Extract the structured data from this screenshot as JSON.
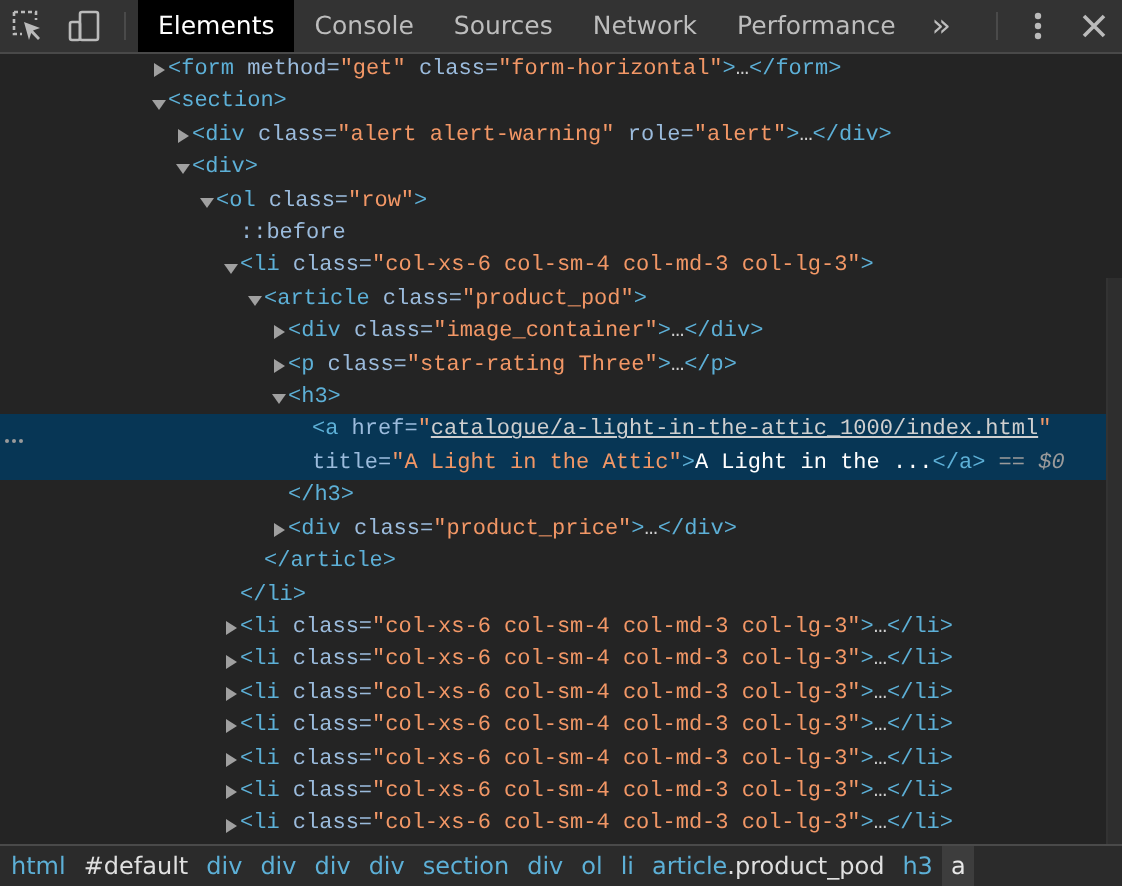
{
  "toolbar": {
    "tabs": [
      {
        "label": "Elements",
        "selected": true
      },
      {
        "label": "Console",
        "selected": false
      },
      {
        "label": "Sources",
        "selected": false
      },
      {
        "label": "Network",
        "selected": false
      },
      {
        "label": "Performance",
        "selected": false
      }
    ],
    "overflow": "»"
  },
  "dom_tree": [
    {
      "selected": false,
      "expanded": false,
      "parts": [
        {
          "kind": "tag",
          "text": "<form"
        },
        {
          "kind": "attr",
          "text": " method="
        },
        {
          "kind": "value",
          "text": "\"get\""
        },
        {
          "kind": "attr",
          "text": " class="
        },
        {
          "kind": "value",
          "text": "\"form-horizontal\""
        },
        {
          "kind": "tag",
          "text": ">"
        },
        {
          "kind": "text",
          "text": "…"
        },
        {
          "kind": "tag",
          "text": "</form>"
        }
      ]
    },
    {
      "selected": false,
      "expanded": true,
      "parts": [
        {
          "kind": "tag",
          "text": "<section>"
        }
      ],
      "children": [
        {
          "selected": false,
          "expanded": false,
          "parts": [
            {
              "kind": "tag",
              "text": "<div"
            },
            {
              "kind": "attr",
              "text": " class="
            },
            {
              "kind": "value",
              "text": "\"alert alert-warning\""
            },
            {
              "kind": "attr",
              "text": " role="
            },
            {
              "kind": "value",
              "text": "\"alert\""
            },
            {
              "kind": "tag",
              "text": ">"
            },
            {
              "kind": "text",
              "text": "…"
            },
            {
              "kind": "tag",
              "text": "</div>"
            }
          ]
        },
        {
          "selected": false,
          "expanded": true,
          "parts": [
            {
              "kind": "tag",
              "text": "<div>"
            }
          ],
          "children": [
            {
              "selected": false,
              "expanded": true,
              "parts": [
                {
                  "kind": "tag",
                  "text": "<ol"
                },
                {
                  "kind": "attr",
                  "text": " class="
                },
                {
                  "kind": "value",
                  "text": "\"row\""
                },
                {
                  "kind": "tag",
                  "text": ">"
                }
              ],
              "children": [
                {
                  "selected": false,
                  "parts": [
                    {
                      "kind": "pseudo",
                      "text": "::before"
                    }
                  ]
                },
                {
                  "selected": false,
                  "expanded": true,
                  "parts": [
                    {
                      "kind": "tag",
                      "text": "<li"
                    },
                    {
                      "kind": "attr",
                      "text": " class="
                    },
                    {
                      "kind": "value",
                      "text": "\"col-xs-6 col-sm-4 col-md-3 col-lg-3\""
                    },
                    {
                      "kind": "tag",
                      "text": ">"
                    }
                  ],
                  "children": [
                    {
                      "selected": false,
                      "expanded": true,
                      "parts": [
                        {
                          "kind": "tag",
                          "text": "<article"
                        },
                        {
                          "kind": "attr",
                          "text": " class="
                        },
                        {
                          "kind": "value",
                          "text": "\"product_pod\""
                        },
                        {
                          "kind": "tag",
                          "text": ">"
                        }
                      ],
                      "children": [
                        {
                          "selected": false,
                          "expanded": false,
                          "parts": [
                            {
                              "kind": "tag",
                              "text": "<div"
                            },
                            {
                              "kind": "attr",
                              "text": " class="
                            },
                            {
                              "kind": "value",
                              "text": "\"image_container\""
                            },
                            {
                              "kind": "tag",
                              "text": ">"
                            },
                            {
                              "kind": "text",
                              "text": "…"
                            },
                            {
                              "kind": "tag",
                              "text": "</div>"
                            }
                          ]
                        },
                        {
                          "selected": false,
                          "expanded": false,
                          "parts": [
                            {
                              "kind": "tag",
                              "text": "<p"
                            },
                            {
                              "kind": "attr",
                              "text": " class="
                            },
                            {
                              "kind": "value",
                              "text": "\"star-rating Three\""
                            },
                            {
                              "kind": "tag",
                              "text": ">"
                            },
                            {
                              "kind": "text",
                              "text": "…"
                            },
                            {
                              "kind": "tag",
                              "text": "</p>"
                            }
                          ]
                        },
                        {
                          "selected": false,
                          "expanded": true,
                          "parts": [
                            {
                              "kind": "tag",
                              "text": "<h3>"
                            }
                          ],
                          "children": [
                            {
                              "selected": true,
                              "parts": [
                                {
                                  "kind": "tag",
                                  "text": "<a"
                                },
                                {
                                  "kind": "attr",
                                  "text": " href="
                                },
                                {
                                  "kind": "value",
                                  "text": "\""
                                },
                                {
                                  "kind": "link",
                                  "text": "catalogue/a-light-in-the-attic_1000/index.html"
                                },
                                {
                                  "kind": "value",
                                  "text": "\""
                                },
                                {
                                  "kind": "attr",
                                  "text": " title="
                                },
                                {
                                  "kind": "value",
                                  "text": "\"A Light in the Attic\""
                                },
                                {
                                  "kind": "tag",
                                  "text": ">"
                                },
                                {
                                  "kind": "text",
                                  "text": "A Light in the ..."
                                },
                                {
                                  "kind": "tag",
                                  "text": "</a>"
                                },
                                {
                                  "kind": "console",
                                  "text": " == $0"
                                }
                              ]
                            }
                          ],
                          "closing": [
                            {
                              "kind": "tag",
                              "text": "</h3>"
                            }
                          ]
                        },
                        {
                          "selected": false,
                          "expanded": false,
                          "parts": [
                            {
                              "kind": "tag",
                              "text": "<div"
                            },
                            {
                              "kind": "attr",
                              "text": " class="
                            },
                            {
                              "kind": "value",
                              "text": "\"product_price\""
                            },
                            {
                              "kind": "tag",
                              "text": ">"
                            },
                            {
                              "kind": "text",
                              "text": "…"
                            },
                            {
                              "kind": "tag",
                              "text": "</div>"
                            }
                          ]
                        }
                      ],
                      "closing": [
                        {
                          "kind": "tag",
                          "text": "</article>"
                        }
                      ]
                    }
                  ],
                  "closing": [
                    {
                      "kind": "tag",
                      "text": "</li>"
                    }
                  ]
                },
                {
                  "selected": false,
                  "expanded": false,
                  "parts": [
                    {
                      "kind": "tag",
                      "text": "<li"
                    },
                    {
                      "kind": "attr",
                      "text": " class="
                    },
                    {
                      "kind": "value",
                      "text": "\"col-xs-6 col-sm-4 col-md-3 col-lg-3\""
                    },
                    {
                      "kind": "tag",
                      "text": ">"
                    },
                    {
                      "kind": "text",
                      "text": "…"
                    },
                    {
                      "kind": "tag",
                      "text": "</li>"
                    }
                  ]
                },
                {
                  "selected": false,
                  "expanded": false,
                  "parts": [
                    {
                      "kind": "tag",
                      "text": "<li"
                    },
                    {
                      "kind": "attr",
                      "text": " class="
                    },
                    {
                      "kind": "value",
                      "text": "\"col-xs-6 col-sm-4 col-md-3 col-lg-3\""
                    },
                    {
                      "kind": "tag",
                      "text": ">"
                    },
                    {
                      "kind": "text",
                      "text": "…"
                    },
                    {
                      "kind": "tag",
                      "text": "</li>"
                    }
                  ]
                },
                {
                  "selected": false,
                  "expanded": false,
                  "parts": [
                    {
                      "kind": "tag",
                      "text": "<li"
                    },
                    {
                      "kind": "attr",
                      "text": " class="
                    },
                    {
                      "kind": "value",
                      "text": "\"col-xs-6 col-sm-4 col-md-3 col-lg-3\""
                    },
                    {
                      "kind": "tag",
                      "text": ">"
                    },
                    {
                      "kind": "text",
                      "text": "…"
                    },
                    {
                      "kind": "tag",
                      "text": "</li>"
                    }
                  ]
                },
                {
                  "selected": false,
                  "expanded": false,
                  "parts": [
                    {
                      "kind": "tag",
                      "text": "<li"
                    },
                    {
                      "kind": "attr",
                      "text": " class="
                    },
                    {
                      "kind": "value",
                      "text": "\"col-xs-6 col-sm-4 col-md-3 col-lg-3\""
                    },
                    {
                      "kind": "tag",
                      "text": ">"
                    },
                    {
                      "kind": "text",
                      "text": "…"
                    },
                    {
                      "kind": "tag",
                      "text": "</li>"
                    }
                  ]
                },
                {
                  "selected": false,
                  "expanded": false,
                  "parts": [
                    {
                      "kind": "tag",
                      "text": "<li"
                    },
                    {
                      "kind": "attr",
                      "text": " class="
                    },
                    {
                      "kind": "value",
                      "text": "\"col-xs-6 col-sm-4 col-md-3 col-lg-3\""
                    },
                    {
                      "kind": "tag",
                      "text": ">"
                    },
                    {
                      "kind": "text",
                      "text": "…"
                    },
                    {
                      "kind": "tag",
                      "text": "</li>"
                    }
                  ]
                },
                {
                  "selected": false,
                  "expanded": false,
                  "parts": [
                    {
                      "kind": "tag",
                      "text": "<li"
                    },
                    {
                      "kind": "attr",
                      "text": " class="
                    },
                    {
                      "kind": "value",
                      "text": "\"col-xs-6 col-sm-4 col-md-3 col-lg-3\""
                    },
                    {
                      "kind": "tag",
                      "text": ">"
                    },
                    {
                      "kind": "text",
                      "text": "…"
                    },
                    {
                      "kind": "tag",
                      "text": "</li>"
                    }
                  ]
                },
                {
                  "selected": false,
                  "expanded": false,
                  "parts": [
                    {
                      "kind": "tag",
                      "text": "<li"
                    },
                    {
                      "kind": "attr",
                      "text": " class="
                    },
                    {
                      "kind": "value",
                      "text": "\"col-xs-6 col-sm-4 col-md-3 col-lg-3\""
                    },
                    {
                      "kind": "tag",
                      "text": ">"
                    },
                    {
                      "kind": "text",
                      "text": "…"
                    },
                    {
                      "kind": "tag",
                      "text": "</li>"
                    }
                  ]
                }
              ]
            }
          ]
        }
      ]
    }
  ],
  "breadcrumbs": [
    {
      "tag": "html",
      "selected": false
    },
    {
      "selector": "#default",
      "selected": false
    },
    {
      "tag": "div",
      "selected": false
    },
    {
      "tag": "div",
      "selected": false
    },
    {
      "tag": "div",
      "selected": false
    },
    {
      "tag": "div",
      "selected": false
    },
    {
      "tag": "section",
      "selected": false
    },
    {
      "tag": "div",
      "selected": false
    },
    {
      "tag": "ol",
      "selected": false
    },
    {
      "tag": "li",
      "selected": false
    },
    {
      "tag": "article",
      "selector": ".product_pod",
      "selected": false
    },
    {
      "tag": "h3",
      "selected": false
    },
    {
      "tag": "a",
      "selected": true
    }
  ]
}
